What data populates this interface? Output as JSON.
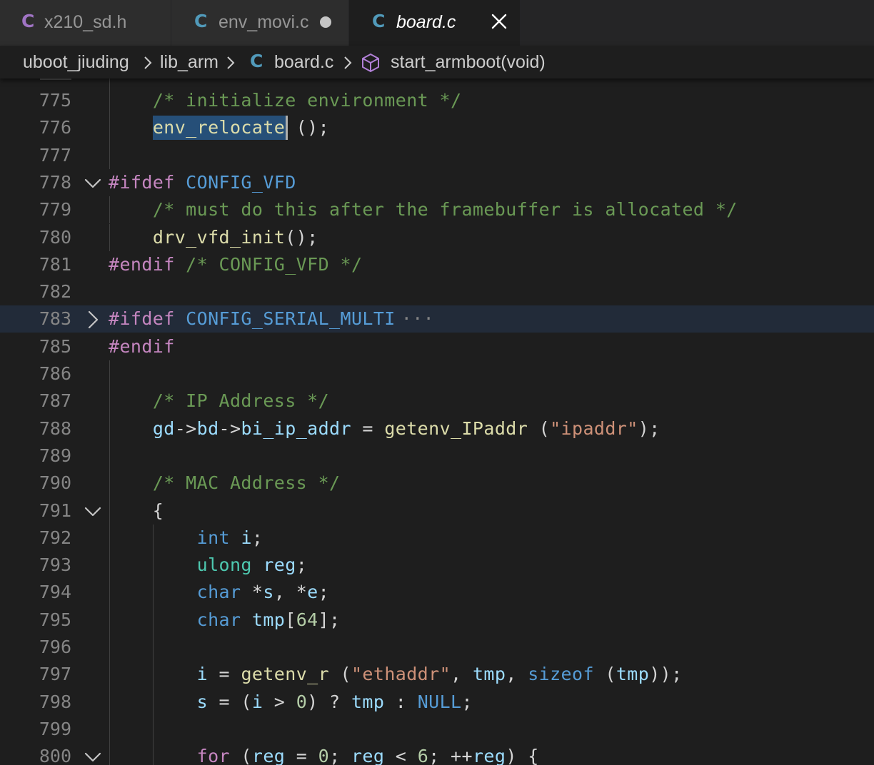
{
  "tabs": [
    {
      "label": "x210_sd.h",
      "icon": "c-file-icon",
      "icon_color": "#a074c4",
      "state": "normal"
    },
    {
      "label": "env_movi.c",
      "icon": "c-file-icon",
      "icon_color": "#519aba",
      "state": "modified"
    },
    {
      "label": "board.c",
      "icon": "c-file-icon",
      "icon_color": "#519aba",
      "state": "active"
    }
  ],
  "breadcrumb": {
    "items": [
      "uboot_jiuding",
      "lib_arm",
      "board.c",
      "start_armboot(void)"
    ],
    "file_icon_letter": "C"
  },
  "icons": {
    "c_letter": "C",
    "close": "close-icon",
    "modified": "modified-dot-icon",
    "fold_expanded": "chevron-down-icon",
    "fold_collapsed": "chevron-right-icon",
    "symbol": "cube-icon"
  },
  "colors": {
    "keyword_preprocessor": "#c586c0",
    "keyword_type": "#569cd6",
    "type_name": "#4ec9b0",
    "function": "#dcdcaa",
    "variable": "#9cdcfe",
    "string": "#ce9178",
    "number": "#b5cea8",
    "comment": "#6a9955",
    "constant": "#4fc1ff",
    "default": "#d4d4d4",
    "selection": "#264f78",
    "line_highlight": "#222b39"
  },
  "editor": {
    "lines": [
      {
        "num": "775",
        "text": "    /* initialize environment */"
      },
      {
        "num": "776",
        "text": "    env_relocate ();"
      },
      {
        "num": "777",
        "text": ""
      },
      {
        "num": "778",
        "text": "#ifdef CONFIG_VFD",
        "fold": "expanded"
      },
      {
        "num": "779",
        "text": "    /* must do this after the framebuffer is allocated */"
      },
      {
        "num": "780",
        "text": "    drv_vfd_init();"
      },
      {
        "num": "781",
        "text": "#endif /* CONFIG_VFD */"
      },
      {
        "num": "782",
        "text": ""
      },
      {
        "num": "783",
        "text": "#ifdef CONFIG_SERIAL_MULTI",
        "fold": "collapsed",
        "folded_marker": "···"
      },
      {
        "num": "785",
        "text": "#endif"
      },
      {
        "num": "786",
        "text": ""
      },
      {
        "num": "787",
        "text": "    /* IP Address */"
      },
      {
        "num": "788",
        "text": "    gd->bd->bi_ip_addr = getenv_IPaddr (\"ipaddr\");"
      },
      {
        "num": "789",
        "text": ""
      },
      {
        "num": "790",
        "text": "    /* MAC Address */"
      },
      {
        "num": "791",
        "text": "    {",
        "fold": "expanded"
      },
      {
        "num": "792",
        "text": "        int i;"
      },
      {
        "num": "793",
        "text": "        ulong reg;"
      },
      {
        "num": "794",
        "text": "        char *s, *e;"
      },
      {
        "num": "795",
        "text": "        char tmp[64];"
      },
      {
        "num": "796",
        "text": ""
      },
      {
        "num": "797",
        "text": "        i = getenv_r (\"ethaddr\", tmp, sizeof (tmp));"
      },
      {
        "num": "798",
        "text": "        s = (i > 0) ? tmp : NULL;"
      },
      {
        "num": "799",
        "text": ""
      },
      {
        "num": "800",
        "text": "        for (reg = 0; reg < 6; ++reg) {",
        "fold": "expanded"
      }
    ]
  }
}
